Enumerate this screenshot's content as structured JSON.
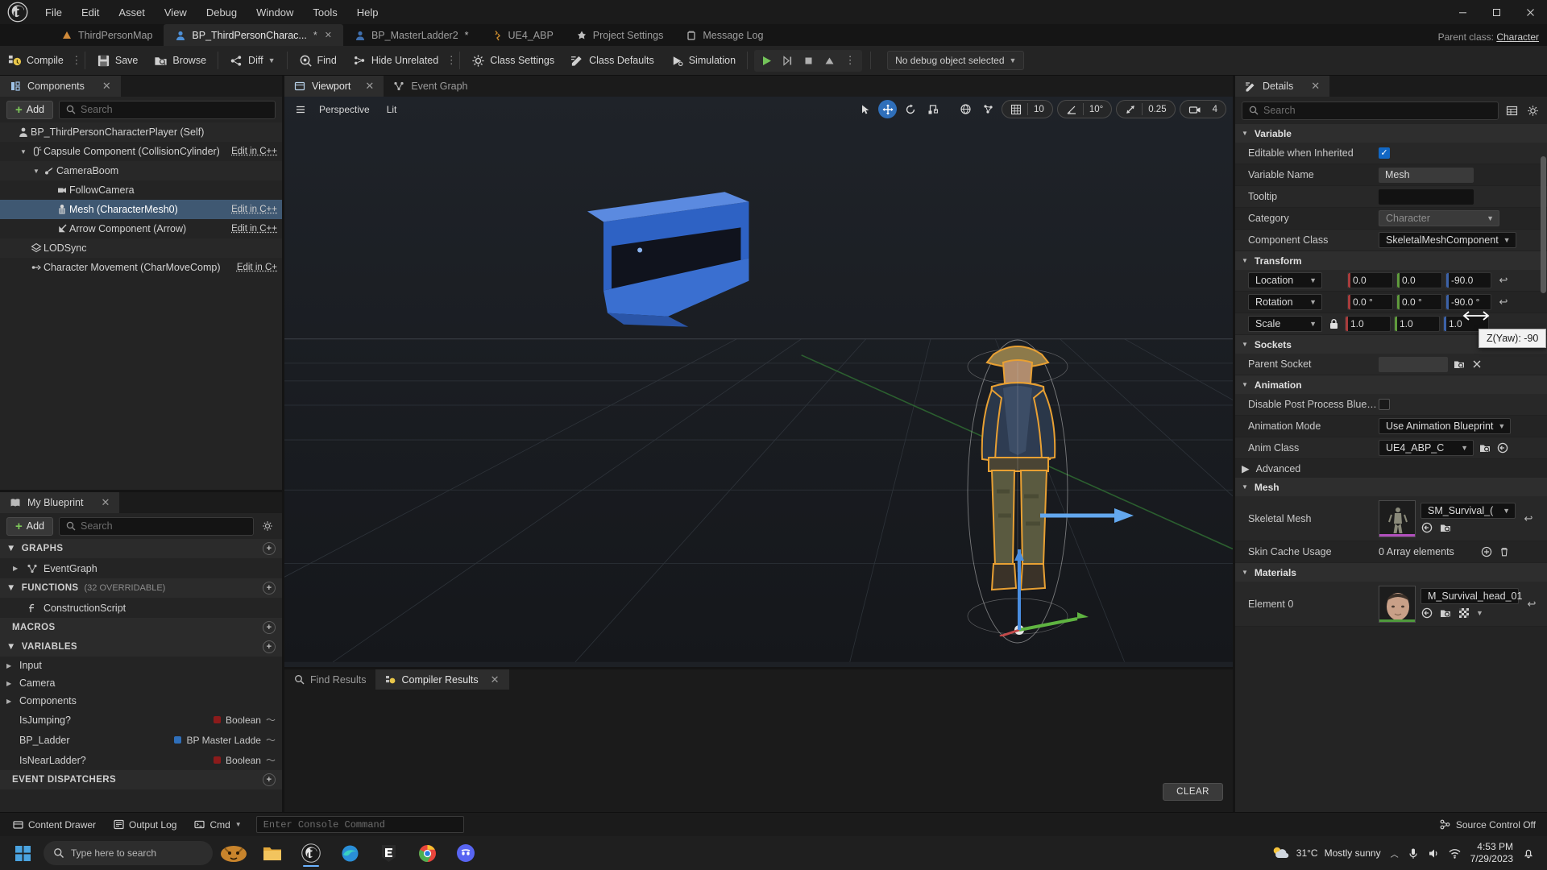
{
  "menubar": {
    "logo_icon": "unreal-engine-logo",
    "items": [
      "File",
      "Edit",
      "Asset",
      "View",
      "Debug",
      "Window",
      "Tools",
      "Help"
    ],
    "window_controls": [
      "minimize",
      "maximize",
      "close"
    ]
  },
  "tabs": [
    {
      "label": "ThirdPersonMap",
      "icon": "level-icon",
      "active": false,
      "dirty": false,
      "closeable": false
    },
    {
      "label": "BP_ThirdPersonCharac...",
      "icon": "blueprint-icon",
      "active": true,
      "dirty": true,
      "closeable": true
    },
    {
      "label": "BP_MasterLadder2",
      "icon": "blueprint-icon",
      "active": false,
      "dirty": true,
      "closeable": false
    },
    {
      "label": "UE4_ABP",
      "icon": "anim-blueprint-icon",
      "active": false,
      "dirty": false,
      "closeable": false
    },
    {
      "label": "Project Settings",
      "icon": "settings-icon",
      "active": false,
      "dirty": false,
      "closeable": false
    },
    {
      "label": "Message Log",
      "icon": "message-log-icon",
      "active": false,
      "dirty": false,
      "closeable": false
    }
  ],
  "parent_class": {
    "label": "Parent class:",
    "value": "Character"
  },
  "toolbar": {
    "compile": "Compile",
    "save": "Save",
    "browse": "Browse",
    "diff": "Diff",
    "find": "Find",
    "hide_unrelated": "Hide Unrelated",
    "class_settings": "Class Settings",
    "class_defaults": "Class Defaults",
    "simulation": "Simulation",
    "play_controls": [
      "play-icon",
      "step-icon",
      "stop-icon",
      "eject-icon",
      "more-options-icon"
    ],
    "debug_object": "No debug object selected"
  },
  "components_panel": {
    "title": "Components",
    "add_label": "Add",
    "search_placeholder": "Search",
    "tree": [
      {
        "label": "BP_ThirdPersonCharacterPlayer (Self)",
        "indent": 0,
        "icon": "character-icon",
        "arrow": "",
        "selected": false,
        "edit_cpp": ""
      },
      {
        "label": "Capsule Component (CollisionCylinder)",
        "indent": 1,
        "icon": "capsule-icon",
        "arrow": "down",
        "selected": false,
        "edit_cpp": "Edit in C++"
      },
      {
        "label": "CameraBoom",
        "indent": 2,
        "icon": "spring-arm-icon",
        "arrow": "down",
        "selected": false,
        "edit_cpp": ""
      },
      {
        "label": "FollowCamera",
        "indent": 3,
        "icon": "camera-icon",
        "arrow": "",
        "selected": false,
        "edit_cpp": ""
      },
      {
        "label": "Mesh (CharacterMesh0)",
        "indent": 3,
        "icon": "skeletal-mesh-icon",
        "arrow": "",
        "selected": true,
        "edit_cpp": "Edit in C++"
      },
      {
        "label": "Arrow Component (Arrow)",
        "indent": 3,
        "icon": "arrow-icon",
        "arrow": "",
        "selected": false,
        "edit_cpp": "Edit in C++"
      },
      {
        "label": "LODSync",
        "indent": 1,
        "icon": "lodsync-icon",
        "arrow": "",
        "selected": false,
        "edit_cpp": ""
      },
      {
        "label": "Character Movement (CharMoveComp)",
        "indent": 1,
        "icon": "movement-icon",
        "arrow": "",
        "selected": false,
        "edit_cpp": "Edit in C+"
      }
    ]
  },
  "my_blueprint_panel": {
    "title": "My Blueprint",
    "add_label": "Add",
    "search_placeholder": "Search",
    "sections": [
      {
        "type": "header",
        "label": "GRAPHS",
        "count": "",
        "expanded": true
      },
      {
        "type": "item",
        "label": "EventGraph",
        "icon": "event-graph-icon",
        "arrow": "right"
      },
      {
        "type": "header",
        "label": "FUNCTIONS",
        "count": "(32 OVERRIDABLE)",
        "expanded": true
      },
      {
        "type": "item",
        "label": "ConstructionScript",
        "icon": "function-icon",
        "arrow": ""
      },
      {
        "type": "header",
        "label": "MACROS",
        "count": "",
        "expanded": false
      },
      {
        "type": "header",
        "label": "VARIABLES",
        "count": "",
        "expanded": true
      },
      {
        "type": "category",
        "label": "Input"
      },
      {
        "type": "category",
        "label": "Camera"
      },
      {
        "type": "category",
        "label": "Components"
      },
      {
        "type": "variable",
        "label": "IsJumping?",
        "vtype": "Boolean",
        "color": "#8c1b1b"
      },
      {
        "type": "variable",
        "label": "BP_Ladder",
        "vtype": "BP Master Ladde",
        "color": "#2f6fba"
      },
      {
        "type": "variable",
        "label": "IsNearLadder?",
        "vtype": "Boolean",
        "color": "#8c1b1b"
      },
      {
        "type": "header",
        "label": "EVENT DISPATCHERS",
        "count": "",
        "expanded": false
      }
    ]
  },
  "viewport": {
    "tabs": [
      {
        "label": "Viewport",
        "icon": "viewport-icon",
        "active": true,
        "closeable": true
      },
      {
        "label": "Event Graph",
        "icon": "event-graph-icon",
        "active": false,
        "closeable": false
      }
    ],
    "perspective": "Perspective",
    "lit": "Lit",
    "grid_snap": "10",
    "angle_snap": "10°",
    "scale_snap": "0.25",
    "camera_speed": "4",
    "transform_modes": [
      "select-icon",
      "translate-icon",
      "rotate-icon",
      "scale-icon"
    ],
    "active_transform_mode": "translate-icon"
  },
  "results_panel": {
    "tabs": [
      {
        "label": "Find Results",
        "icon": "search-icon",
        "active": false,
        "closeable": false
      },
      {
        "label": "Compiler Results",
        "icon": "compiler-icon",
        "active": true,
        "closeable": true
      }
    ],
    "clear_label": "CLEAR"
  },
  "details": {
    "title": "Details",
    "search_placeholder": "Search",
    "sections": [
      {
        "name": "Variable",
        "rows": [
          {
            "key": "Editable when Inherited",
            "kind": "checkbox",
            "checked": true
          },
          {
            "key": "Variable Name",
            "kind": "text",
            "value": "Mesh"
          },
          {
            "key": "Tooltip",
            "kind": "text-dark",
            "value": ""
          },
          {
            "key": "Category",
            "kind": "dropdown-disabled",
            "value": "Character"
          },
          {
            "key": "Component Class",
            "kind": "dropdown",
            "value": "SkeletalMeshComponent"
          }
        ]
      },
      {
        "name": "Transform",
        "rows": [
          {
            "key": "Location",
            "kind": "xyz",
            "x": "0.0",
            "y": "0.0",
            "z": "-90.0",
            "revert": true
          },
          {
            "key": "Rotation",
            "kind": "xyz",
            "x": "0.0 °",
            "y": "0.0 °",
            "z": "-90.0 °",
            "revert": true
          },
          {
            "key": "Scale",
            "kind": "xyz-lock",
            "x": "1.0",
            "y": "1.0",
            "z": "1.0",
            "revert": false
          }
        ]
      },
      {
        "name": "Sockets",
        "rows": [
          {
            "key": "Parent Socket",
            "kind": "socket",
            "value": ""
          }
        ]
      },
      {
        "name": "Animation",
        "rows": [
          {
            "key": "Disable Post Process Bluep...",
            "kind": "checkbox",
            "checked": false
          },
          {
            "key": "Animation Mode",
            "kind": "dropdown",
            "value": "Use Animation Blueprint"
          },
          {
            "key": "Anim Class",
            "kind": "dropdown-asset",
            "value": "UE4_ABP_C"
          }
        ]
      },
      {
        "name": "Advanced",
        "collapsed": true,
        "rows": []
      },
      {
        "name": "Mesh",
        "rows": [
          {
            "key": "Skeletal Mesh",
            "kind": "asset",
            "value": "SM_Survival_(",
            "thumb": "skeletal-mesh-thumb",
            "bar_color": "#b14fbd",
            "revert": true
          },
          {
            "key": "Skin Cache Usage",
            "kind": "array",
            "value": "0 Array elements"
          }
        ]
      },
      {
        "name": "Materials",
        "rows": [
          {
            "key": "Element 0",
            "kind": "material",
            "value": "M_Survival_head_01",
            "thumb": "material-head-thumb",
            "bar_color": "#4f9a3c",
            "revert": true
          }
        ]
      }
    ],
    "tooltip": {
      "text": "Z(Yaw): -90",
      "visible": true
    }
  },
  "statusbar": {
    "content_drawer": "Content Drawer",
    "output_log": "Output Log",
    "cmd_label": "Cmd",
    "console_placeholder": "Enter Console Command",
    "source_control": "Source Control Off"
  },
  "taskbar": {
    "search_placeholder": "Type here to search",
    "apps": [
      "file-explorer-icon",
      "unreal-engine-icon",
      "edge-icon",
      "epic-games-icon",
      "chrome-icon",
      "discord-icon"
    ],
    "weather": {
      "temp": "31°C",
      "desc": "Mostly sunny"
    },
    "time": "4:53 PM",
    "date": "7/29/2023",
    "tray_icons": [
      "up-chevron-icon",
      "mic-icon",
      "volume-icon",
      "network-icon",
      "notification-icon"
    ]
  },
  "colors": {
    "accent_blue": "#2f6fba",
    "selection": "#3f5872",
    "axis_x": "#a83c3c",
    "axis_y": "#5f9a3c",
    "axis_z": "#3c62a8",
    "green_play": "#7ec95a"
  }
}
